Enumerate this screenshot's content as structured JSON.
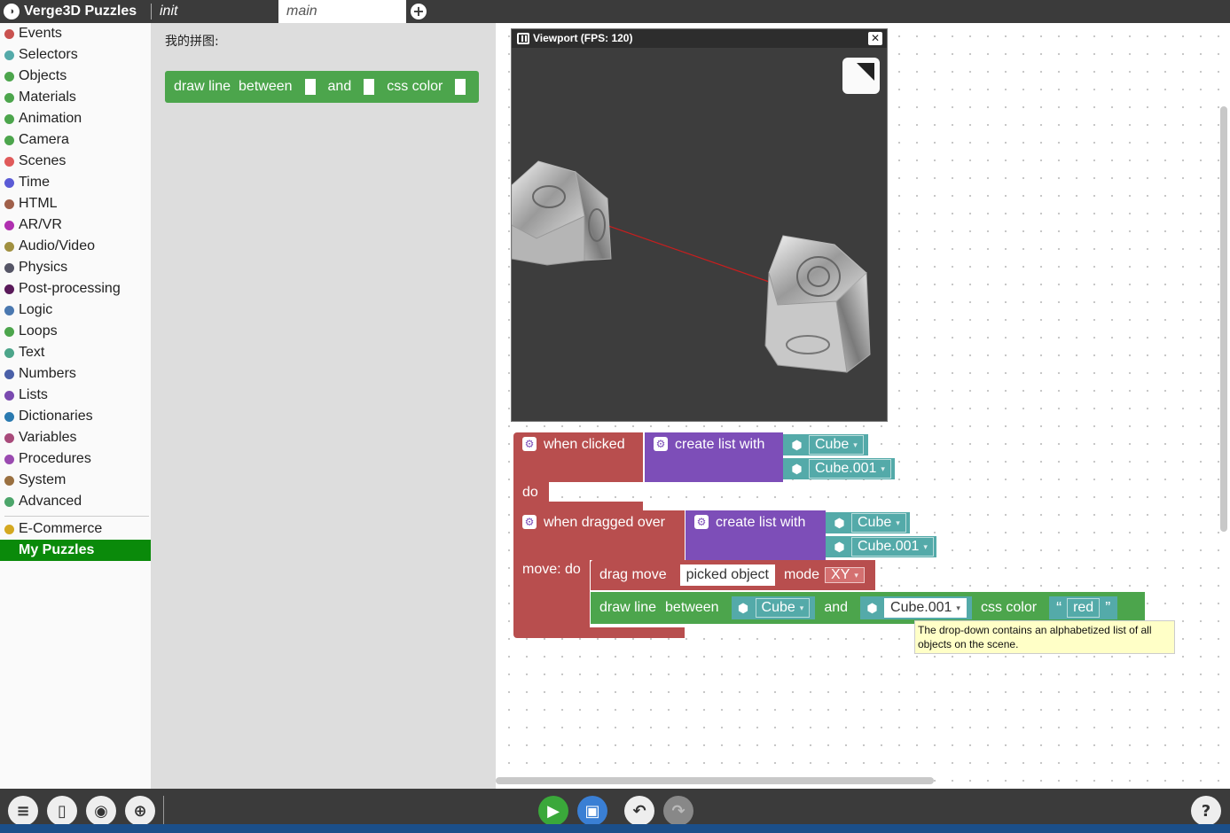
{
  "app": {
    "title": "Verge3D Puzzles",
    "logo_glyph": "◑"
  },
  "tabs": [
    {
      "label": "init"
    },
    {
      "label": "main"
    }
  ],
  "add_tab_glyph": "+",
  "sidebar": {
    "categories": [
      {
        "label": "Events",
        "color": "#c9524f"
      },
      {
        "label": "Selectors",
        "color": "#54aaa9"
      },
      {
        "label": "Objects",
        "color": "#4ca54c"
      },
      {
        "label": "Materials",
        "color": "#4ca54c"
      },
      {
        "label": "Animation",
        "color": "#4ca54c"
      },
      {
        "label": "Camera",
        "color": "#4ca54c"
      },
      {
        "label": "Scenes",
        "color": "#e05a5a"
      },
      {
        "label": "Time",
        "color": "#5b5bd6"
      },
      {
        "label": "HTML",
        "color": "#a0604a"
      },
      {
        "label": "AR/VR",
        "color": "#b030b0"
      },
      {
        "label": "Audio/Video",
        "color": "#a09040"
      },
      {
        "label": "Physics",
        "color": "#555566"
      },
      {
        "label": "Post-processing",
        "color": "#5a1a5a"
      },
      {
        "label": "Logic",
        "color": "#4a78b0"
      },
      {
        "label": "Loops",
        "color": "#4ca54c"
      },
      {
        "label": "Text",
        "color": "#4ca58a"
      },
      {
        "label": "Numbers",
        "color": "#4a60a8"
      },
      {
        "label": "Lists",
        "color": "#7a4ab0"
      },
      {
        "label": "Dictionaries",
        "color": "#2a7ab0"
      },
      {
        "label": "Variables",
        "color": "#a84a7a"
      },
      {
        "label": "Procedures",
        "color": "#9a4ab0"
      },
      {
        "label": "System",
        "color": "#9a7040"
      },
      {
        "label": "Advanced",
        "color": "#4ca56a"
      }
    ],
    "extra": [
      {
        "label": "E-Commerce",
        "color": "#d4a820"
      }
    ],
    "selected": {
      "label": "My Puzzles"
    }
  },
  "flyout": {
    "label": "我的拼图:",
    "block": {
      "part1": "draw line",
      "part2": "between",
      "part3": "and",
      "part4": "css color"
    }
  },
  "viewport": {
    "title": "Viewport (FPS: 120)",
    "close": "✕"
  },
  "workspace": {
    "clicked_block": {
      "label": "when clicked",
      "do": "do",
      "list_label": "create list with",
      "item1": "Cube",
      "item2": "Cube.001"
    },
    "dragged_block": {
      "label": "when dragged over",
      "move_do": "move: do",
      "list_label": "create list with",
      "item1": "Cube",
      "item2": "Cube.001",
      "drag_move": "drag move",
      "picked": "picked object",
      "mode": "mode",
      "mode_value": "XY",
      "draw_line": "draw line",
      "between": "between",
      "line_from": "Cube",
      "and": "and",
      "line_to": "Cube.001",
      "css_color": "css color",
      "color_value": "red",
      "quote_open": "“",
      "quote_close": "”"
    }
  },
  "tooltip": "The drop-down contains an alphabetized list of all objects on the scene.",
  "toolbar": {
    "menu": "≡",
    "panel": "▯",
    "screenshot": "◉",
    "target": "⊕",
    "play": "▶",
    "save": "▣",
    "undo": "↶",
    "redo": "↷",
    "help": "?"
  },
  "colors": {
    "green": "#4ca54c",
    "red": "#b84e4e",
    "purple": "#7d4eb8",
    "teal": "#54aaa9",
    "selected": "#0a8a0a"
  }
}
